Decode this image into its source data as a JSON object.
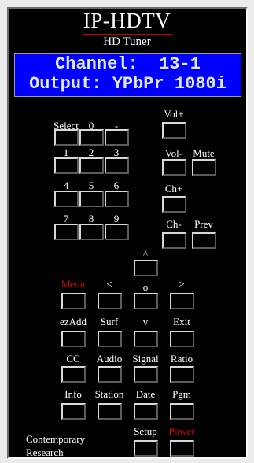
{
  "header": {
    "title": "IP-HDTV",
    "subtitle": "HD Tuner"
  },
  "display": {
    "line1": "Channel:  13-1",
    "line2": "Output: YPbPr 1080i"
  },
  "buttons": {
    "select": "Select",
    "zero": "0",
    "dash": "-",
    "vol_up": "Vol+",
    "one": "1",
    "two": "2",
    "three": "3",
    "vol_down": "Vol-",
    "mute": "Mute",
    "four": "4",
    "five": "5",
    "six": "6",
    "ch_up": "Ch+",
    "seven": "7",
    "eight": "8",
    "nine": "9",
    "ch_down": "Ch-",
    "prev": "Prev",
    "up": "^",
    "menu": "Menu",
    "left": "<",
    "ok": "o",
    "right": ">",
    "ezadd": "ezAdd",
    "surf": "Surf",
    "down": "v",
    "exit": "Exit",
    "cc": "CC",
    "audio": "Audio",
    "signal": "Signal",
    "ratio": "Ratio",
    "info": "Info",
    "station": "Station",
    "date": "Date",
    "pgm": "Pgm",
    "setup": "Setup",
    "power": "Power"
  },
  "footer": {
    "line1": "Contemporary",
    "line2": "Research"
  },
  "colors": {
    "display_bg": "#0000ff",
    "accent_red": "#e00000",
    "panel_bg": "#000000"
  }
}
